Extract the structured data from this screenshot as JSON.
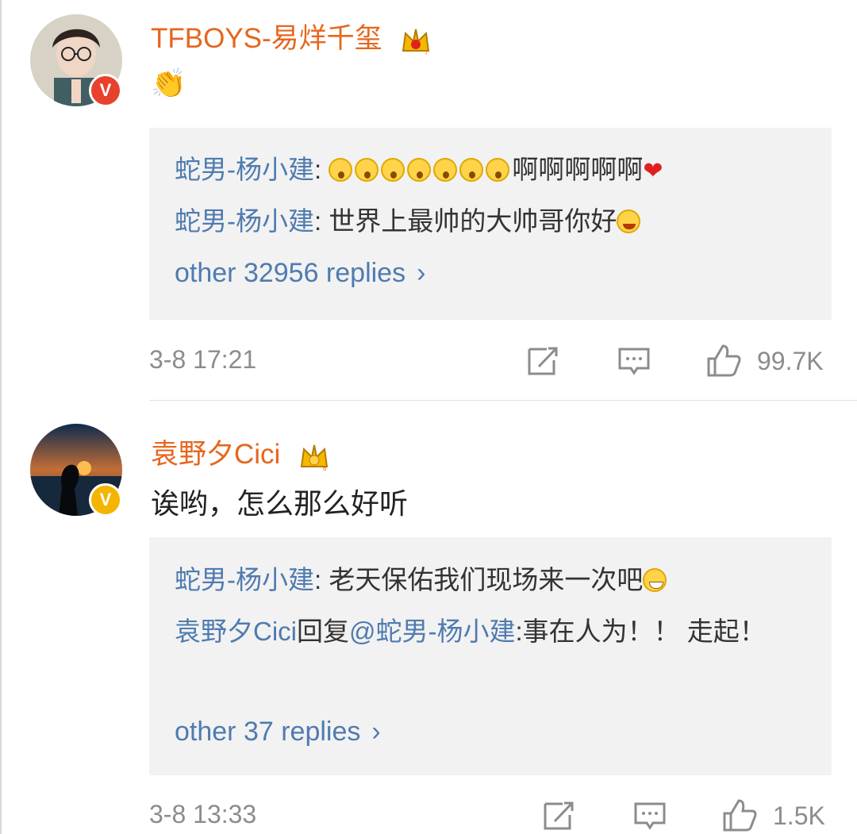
{
  "comments": [
    {
      "username": "TFBOYS-易烊千玺",
      "content": "👏",
      "replies": [
        {
          "name": "蛇男-杨小建",
          "text": ":",
          "after": "啊啊啊啊啊"
        },
        {
          "name": "蛇男-杨小建",
          "text": ": 世界上最帅的大帅哥你好"
        }
      ],
      "more": "other 32956 replies",
      "time": "3-8 17:21",
      "likes": "99.7K"
    },
    {
      "username": "袁野夕Cici",
      "content": "诶哟，怎么那么好听",
      "replies": [
        {
          "name": "蛇男-杨小建",
          "text": ": 老天保佑我们现场来一次吧"
        },
        {
          "name": "袁野夕Cici",
          "text": "回复",
          "mention": "@蛇男-杨小建",
          "after": ":事在人为！！ 走起！"
        }
      ],
      "more": "other 37 replies",
      "time": "3-8 13:33",
      "likes": "1.5K"
    }
  ],
  "colors": {
    "username": "#e6661d",
    "reply_name": "#4f7bb0",
    "meta": "#8c8c8c",
    "reply_bg": "#f2f2f2"
  },
  "icons": [
    "share-icon",
    "comment-icon",
    "like-icon",
    "crown-icon",
    "verified-badge"
  ]
}
